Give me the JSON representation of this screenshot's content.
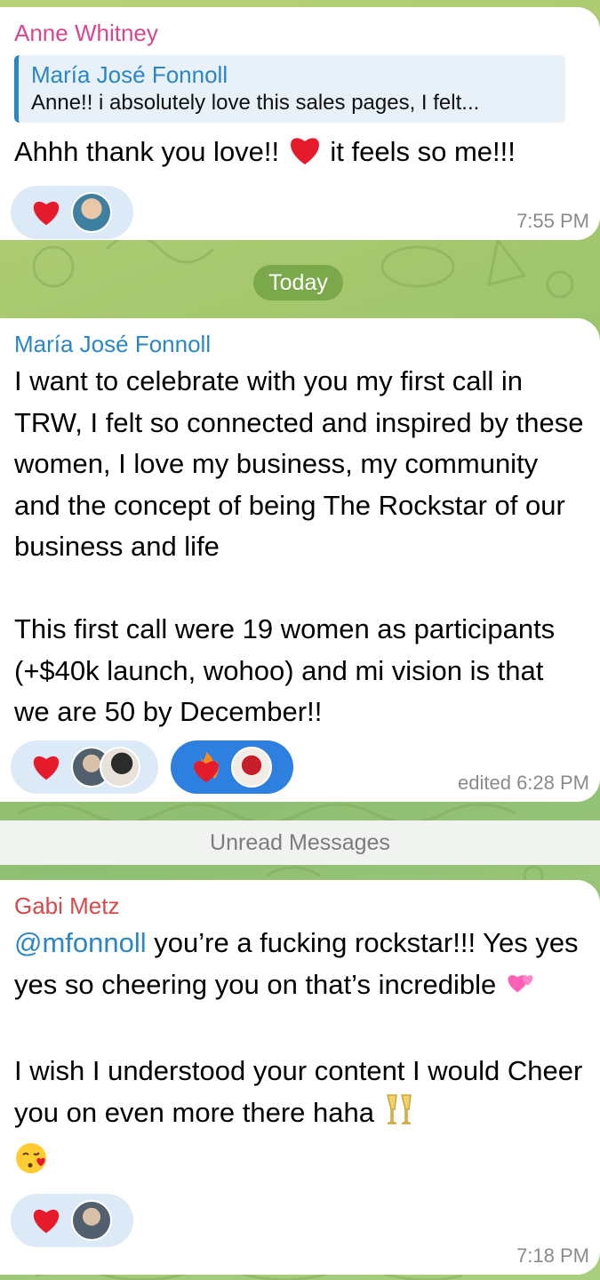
{
  "messages": [
    {
      "sender": "Anne Whitney",
      "sender_color": "#d6488e",
      "reply": {
        "name": "María José Fonnoll",
        "text": "Anne!! i absolutely love this sales pages, I felt..."
      },
      "text_before_emoji": "Ahhh thank you love!! ",
      "text_after_emoji": " it feels so me!!!",
      "reactions": [
        {
          "emoji": "red-heart",
          "count_avatars": 1
        }
      ],
      "time": "7:55 PM"
    },
    {
      "sender": "María José Fonnoll",
      "sender_color": "#2b86c5",
      "text": "I want to celebrate with you my first call in TRW, I felt so connected and inspired by these women, I love my business, my community and the concept of being The Rockstar of our business and life\n\nThis first call were 19 women as participants (+$40k launch, wohoo) and mi vision is that we are 50 by December!!",
      "reactions": [
        {
          "emoji": "red-heart",
          "count_avatars": 2
        },
        {
          "emoji": "heart-on-fire",
          "count_avatars": 1,
          "active": true
        }
      ],
      "time": "edited 6:28 PM"
    },
    {
      "sender": "Gabi Metz",
      "sender_color": "#d44a4a",
      "mention": "@mfonnoll",
      "text_part1": " you’re a fucking rockstar!!! Yes yes yes so cheering you on that’s incredible ",
      "text_part2": "\n\nI wish I understood your content I would Cheer you on even more there haha ",
      "reactions": [
        {
          "emoji": "red-heart",
          "count_avatars": 1
        }
      ],
      "time": "7:18 PM"
    }
  ],
  "date_separator": "Today",
  "unread_label": "Unread Messages",
  "colors": {
    "bubble": "#ffffff",
    "reaction_bg": "#dce9f6",
    "reaction_active_bg": "#2d7fe0",
    "date_pill": "#7aa84b"
  },
  "icons": {
    "heart": "red-heart-icon",
    "fire_heart": "heart-on-fire-icon",
    "two_hearts": "two-hearts-icon",
    "champagne": "clinking-glasses-icon",
    "kiss": "face-blowing-kiss-icon"
  }
}
